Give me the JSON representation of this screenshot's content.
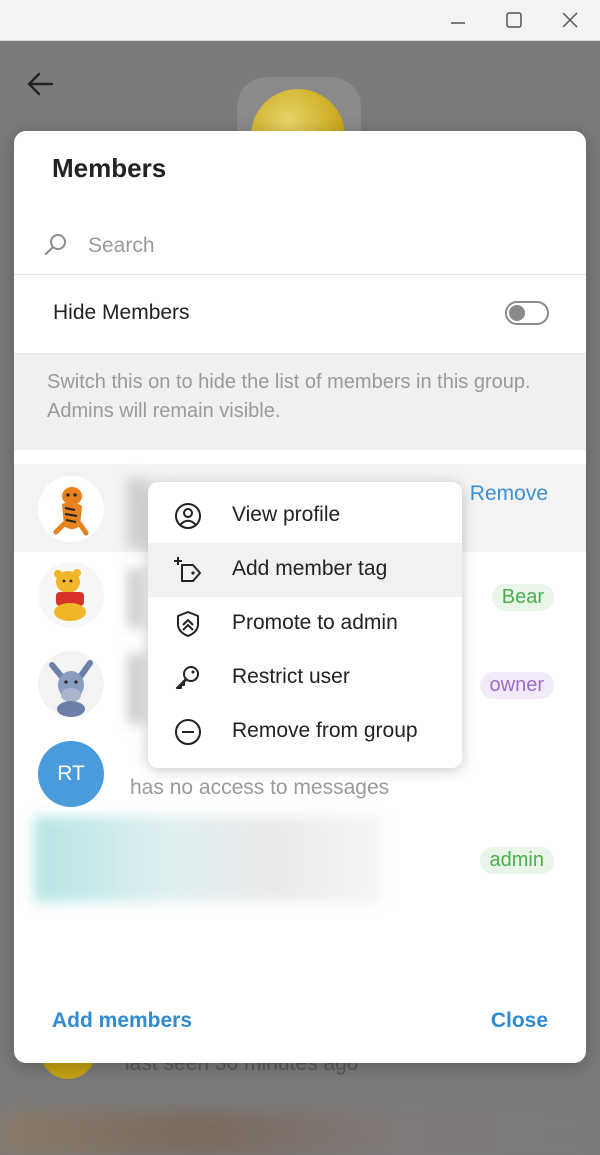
{
  "dialog": {
    "title": "Members",
    "search_placeholder": "Search",
    "hide_members_label": "Hide Members",
    "hide_members_enabled": false,
    "hint": "Switch this on to hide the list of members in this group. Admins will remain visible.",
    "add_members": "Add members",
    "close": "Close"
  },
  "members": [
    {
      "action": "Remove"
    },
    {
      "badge": "Bear",
      "badge_color": "#4caf50"
    },
    {
      "badge": "owner",
      "badge_color": "#a06bc8"
    },
    {
      "initials": "RT",
      "status": "has no access to messages"
    },
    {
      "badge": "admin",
      "badge_color": "#4caf50"
    }
  ],
  "context_menu": {
    "items": [
      {
        "label": "View profile",
        "icon": "user-circle-icon"
      },
      {
        "label": "Add member tag",
        "icon": "tag-plus-icon"
      },
      {
        "label": "Promote to admin",
        "icon": "shield-icon"
      },
      {
        "label": "Restrict user",
        "icon": "key-icon"
      },
      {
        "label": "Remove from group",
        "icon": "minus-circle-icon"
      }
    ]
  },
  "background": {
    "last_seen": "last seen 30 minutes ago"
  }
}
